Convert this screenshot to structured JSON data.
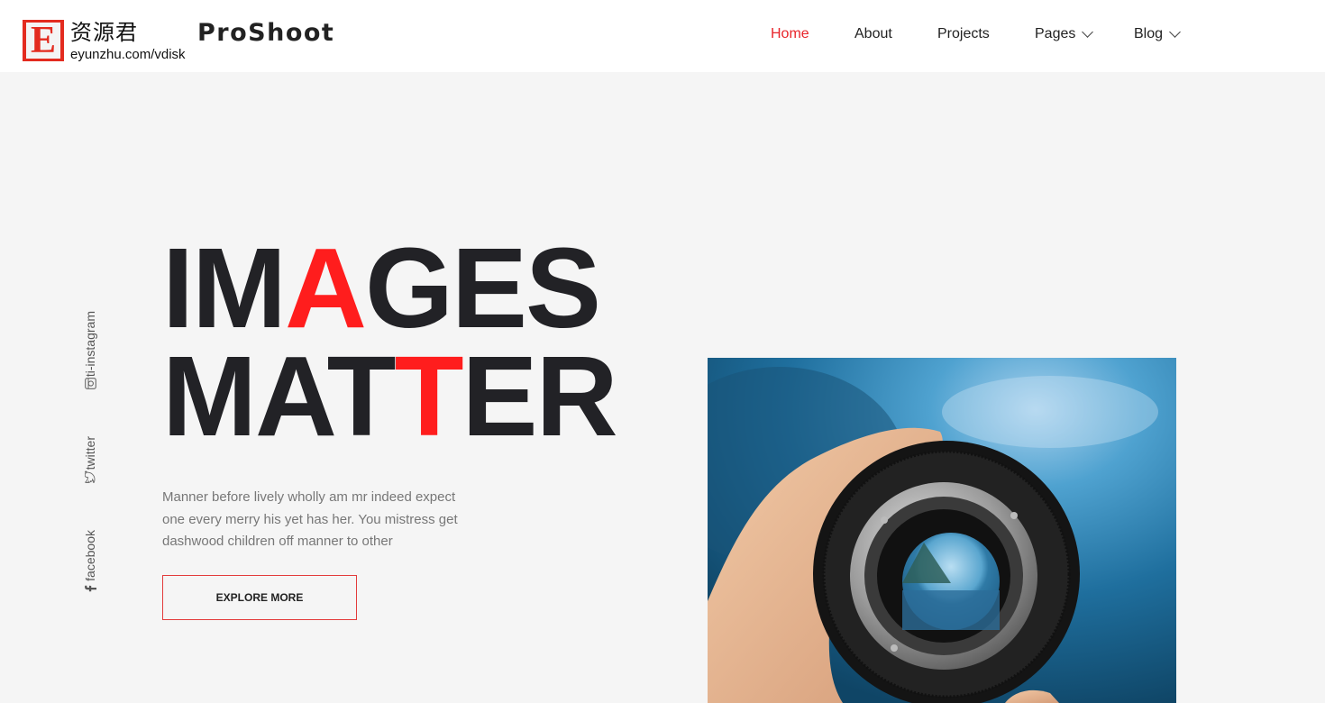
{
  "header": {
    "logo_letter": "E",
    "logo_cn": "资源君",
    "logo_url": "eyunzhu.com/vdisk",
    "brand": "ProShoot",
    "nav": [
      {
        "label": "Home",
        "active": true,
        "dropdown": false
      },
      {
        "label": "About",
        "active": false,
        "dropdown": false
      },
      {
        "label": "Projects",
        "active": false,
        "dropdown": false
      },
      {
        "label": "Pages",
        "active": false,
        "dropdown": true
      },
      {
        "label": "Blog",
        "active": false,
        "dropdown": true
      }
    ]
  },
  "social": [
    {
      "label": "ti-instagram",
      "icon": "instagram-icon"
    },
    {
      "label": "twitter",
      "icon": "twitter-icon"
    },
    {
      "label": "facebook",
      "icon": "facebook-icon"
    }
  ],
  "hero": {
    "line1": {
      "before": "IM",
      "accent": "A",
      "after": "GES"
    },
    "line2": {
      "before": "MAT",
      "accent": "T",
      "after": "ER"
    },
    "description": "Manner before lively wholly am mr indeed expect one every merry his yet has her. You mistress get dashwood children off manner to other",
    "cta_label": "EXPLORE MORE",
    "image_alt": "Hand holding a camera lens showing a lake and mountains"
  },
  "colors": {
    "accent": "#e8242a",
    "headline": "#222226",
    "background": "#f5f5f5"
  }
}
